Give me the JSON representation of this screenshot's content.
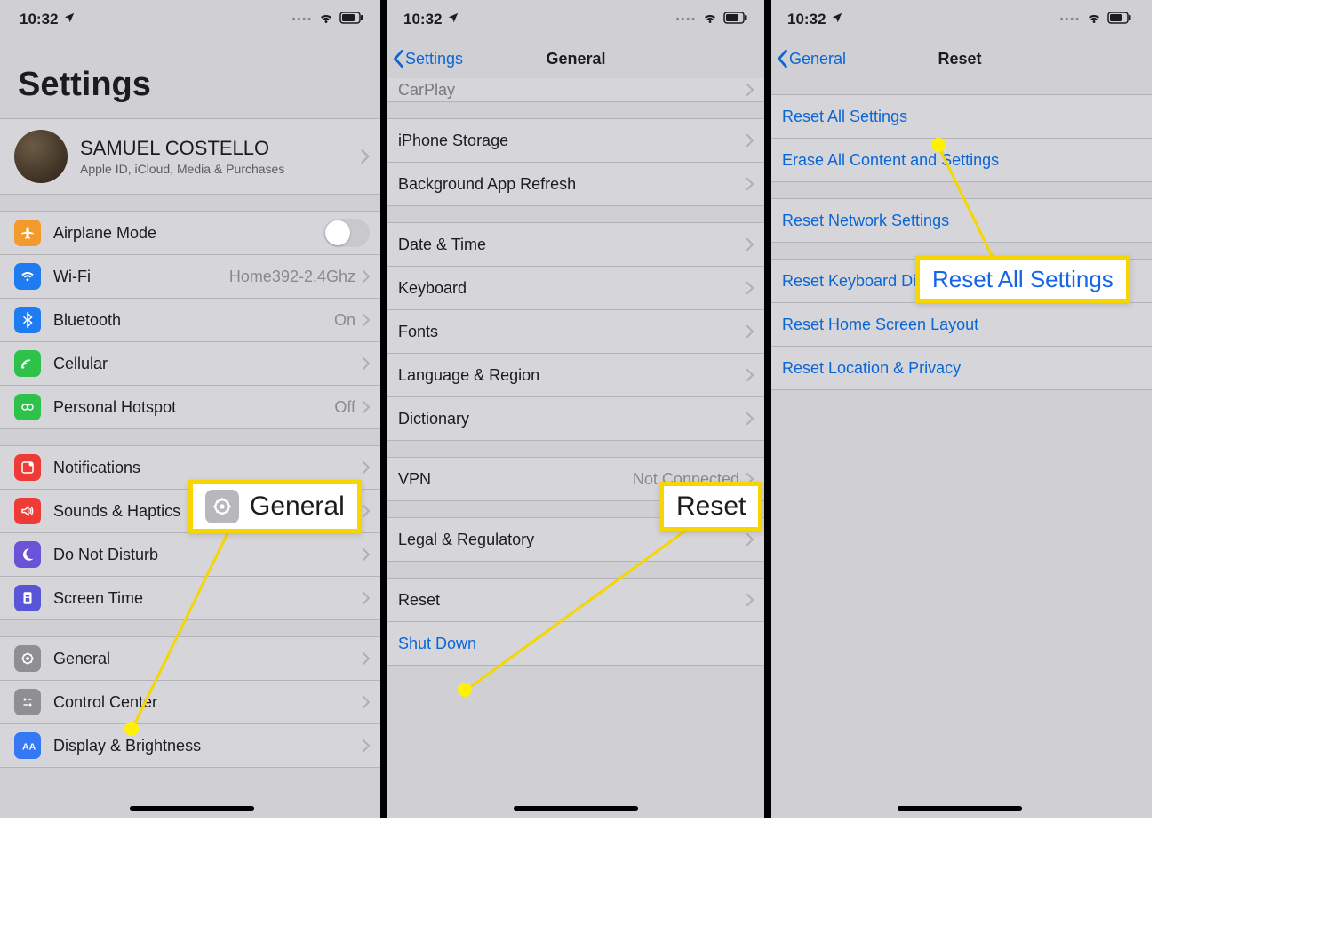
{
  "statusbar": {
    "time": "10:32"
  },
  "screen1": {
    "title": "Settings",
    "profile": {
      "name": "SAMUEL COSTELLO",
      "sub": "Apple ID, iCloud, Media & Purchases"
    },
    "groupA": [
      {
        "icon": "airplane-icon",
        "label": "Airplane Mode",
        "type": "toggle"
      },
      {
        "icon": "wifi-icon",
        "label": "Wi-Fi",
        "value": "Home392-2.4Ghz"
      },
      {
        "icon": "bluetooth-icon",
        "label": "Bluetooth",
        "value": "On"
      },
      {
        "icon": "cellular-icon",
        "label": "Cellular"
      },
      {
        "icon": "hotspot-icon",
        "label": "Personal Hotspot",
        "value": "Off"
      }
    ],
    "groupB": [
      {
        "icon": "notifications-icon",
        "label": "Notifications"
      },
      {
        "icon": "sounds-icon",
        "label": "Sounds & Haptics"
      },
      {
        "icon": "dnd-icon",
        "label": "Do Not Disturb"
      },
      {
        "icon": "screentime-icon",
        "label": "Screen Time"
      }
    ],
    "groupC": [
      {
        "icon": "general-icon",
        "label": "General"
      },
      {
        "icon": "controlcenter-icon",
        "label": "Control Center"
      },
      {
        "icon": "display-icon",
        "label": "Display & Brightness"
      }
    ]
  },
  "screen2": {
    "back": "Settings",
    "title": "General",
    "partial": "CarPlay",
    "groupA": [
      {
        "label": "iPhone Storage"
      },
      {
        "label": "Background App Refresh"
      }
    ],
    "groupB": [
      {
        "label": "Date & Time"
      },
      {
        "label": "Keyboard"
      },
      {
        "label": "Fonts"
      },
      {
        "label": "Language & Region"
      },
      {
        "label": "Dictionary"
      }
    ],
    "groupC": [
      {
        "label": "VPN",
        "value": "Not Connected"
      }
    ],
    "groupD": [
      {
        "label": "Legal & Regulatory"
      }
    ],
    "groupE": [
      {
        "label": "Reset"
      },
      {
        "label": "Shut Down",
        "link": true
      }
    ]
  },
  "screen3": {
    "back": "General",
    "title": "Reset",
    "groupA": [
      {
        "label": "Reset All Settings"
      },
      {
        "label": "Erase All Content and Settings"
      }
    ],
    "groupB": [
      {
        "label": "Reset Network Settings"
      }
    ],
    "groupC": [
      {
        "label": "Reset Keyboard Dictionary"
      },
      {
        "label": "Reset Home Screen Layout"
      },
      {
        "label": "Reset Location & Privacy"
      }
    ]
  },
  "callouts": {
    "c1": "General",
    "c2": "Reset",
    "c3": "Reset All Settings"
  }
}
